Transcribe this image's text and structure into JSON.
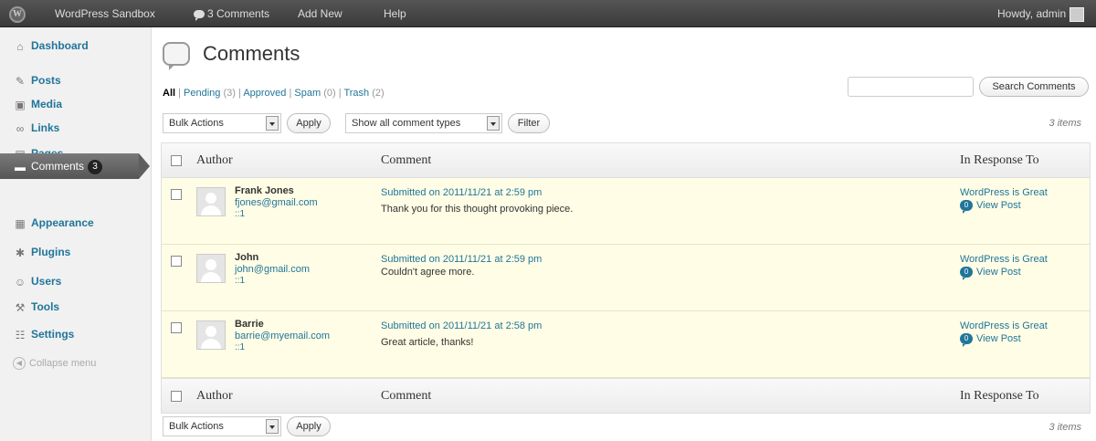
{
  "admin_bar": {
    "site_name": "WordPress Sandbox",
    "comments_label": "3 Comments",
    "add_new": "Add New",
    "help": "Help",
    "howdy": "Howdy, admin"
  },
  "sidebar": {
    "items": [
      {
        "label": "Dashboard",
        "icon": "dashboard-icon"
      },
      {
        "label": "Posts",
        "icon": "posts-icon"
      },
      {
        "label": "Media",
        "icon": "media-icon"
      },
      {
        "label": "Links",
        "icon": "links-icon"
      },
      {
        "label": "Pages",
        "icon": "pages-icon"
      },
      {
        "label": "Comments",
        "icon": "comments-icon",
        "badge": "3",
        "current": true
      },
      {
        "label": "Appearance",
        "icon": "appearance-icon"
      },
      {
        "label": "Plugins",
        "icon": "plugins-icon"
      },
      {
        "label": "Users",
        "icon": "users-icon"
      },
      {
        "label": "Tools",
        "icon": "tools-icon"
      },
      {
        "label": "Settings",
        "icon": "settings-icon"
      }
    ],
    "collapse_label": "Collapse menu"
  },
  "page": {
    "title": "Comments",
    "filters": {
      "all": "All",
      "pending": "Pending",
      "pending_count": "(3)",
      "approved": "Approved",
      "spam": "Spam",
      "spam_count": "(0)",
      "trash": "Trash",
      "trash_count": "(2)",
      "separator": "|"
    },
    "search_button": "Search Comments",
    "search_value": "",
    "bulk_actions": "Bulk Actions",
    "apply": "Apply",
    "comment_types": "Show all comment types",
    "filter": "Filter",
    "items_count": "3 items"
  },
  "table": {
    "columns": {
      "author": "Author",
      "comment": "Comment",
      "response": "In Response To"
    },
    "rows": [
      {
        "author": "Frank Jones",
        "email": "fjones@gmail.com",
        "ip": "::1",
        "submitted": "Submitted on 2011/11/21 at 2:59 pm",
        "text": "Thank you for this thought provoking piece.",
        "post": "WordPress is Great",
        "post_count": "0",
        "view_post": "View Post"
      },
      {
        "author": "John",
        "email": "john@gmail.com",
        "ip": "::1",
        "submitted": "Submitted on 2011/11/21 at 2:59 pm",
        "text": "Couldn't agree more.",
        "post": "WordPress is Great",
        "post_count": "0",
        "view_post": "View Post"
      },
      {
        "author": "Barrie",
        "email": "barrie@myemail.com",
        "ip": "::1",
        "submitted": "Submitted on 2011/11/21 at 2:58 pm",
        "text": "Great article, thanks!",
        "post": "WordPress is Great",
        "post_count": "0",
        "view_post": "View Post"
      }
    ]
  },
  "colors": {
    "link": "#21759b",
    "row_highlight": "#fffde5",
    "admin_bar": "#464646"
  }
}
